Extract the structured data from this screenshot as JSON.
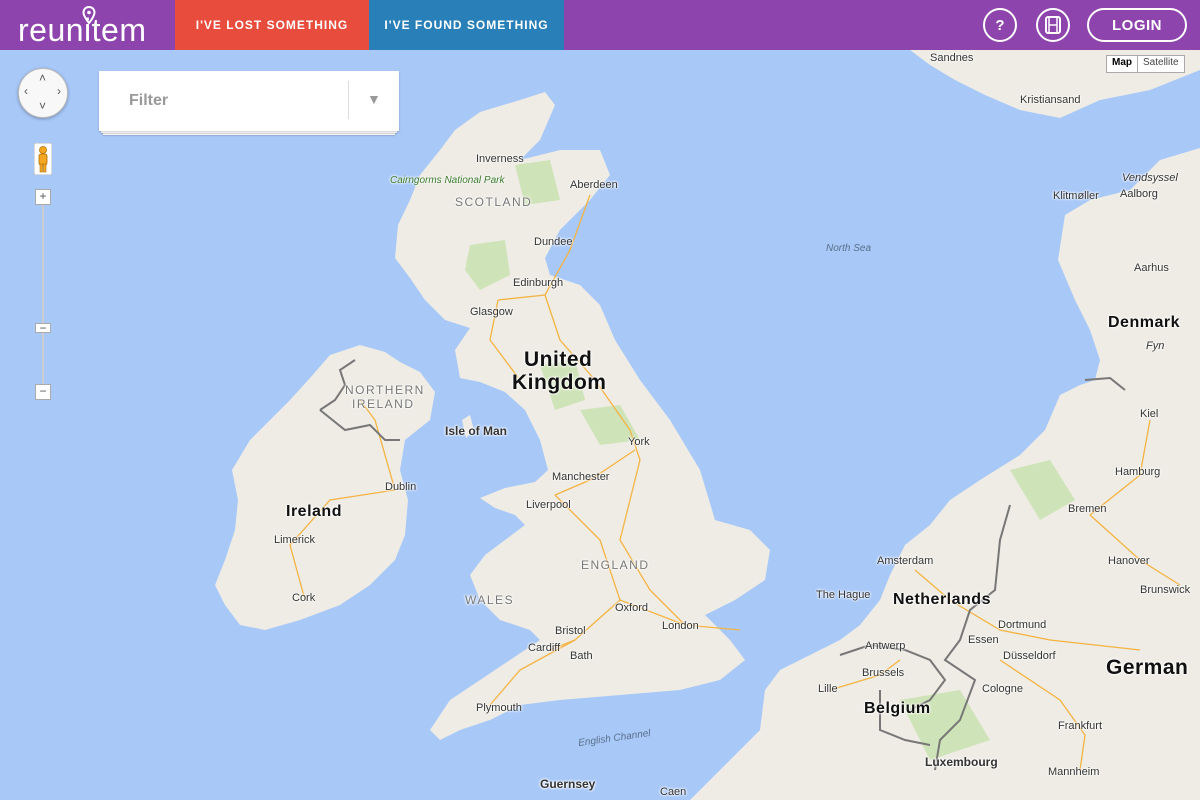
{
  "header": {
    "logo_text": "reunitem",
    "nav_lost": "I'VE LOST SOMETHING",
    "nav_found": "I'VE FOUND SOMETHING",
    "help_label": "?",
    "login_label": "LOGIN",
    "colors": {
      "bar": "#8e44ad",
      "lost": "#e74c3c",
      "found": "#2980b9"
    }
  },
  "filter": {
    "label": "Filter"
  },
  "map_controls": {
    "zoom_in": "+",
    "zoom_out": "−",
    "maptype_map": "Map",
    "maptype_satellite": "Satellite",
    "pan_icon": "pan-icon",
    "pegman_icon": "pegman-icon"
  },
  "map_labels": {
    "sandnes": "Sandnes",
    "kristiansand": "Kristiansand",
    "vendsyssel": "Vendsyssel",
    "klitmoller": "Klitmøller",
    "aalborg": "Aalborg",
    "aarhus": "Aarhus",
    "denmark": "Denmark",
    "fyn": "Fyn",
    "kiel": "Kiel",
    "hamburg": "Hamburg",
    "bremen": "Bremen",
    "hanover": "Hanover",
    "brunswick": "Brunswick",
    "germany": "German",
    "inverness": "Inverness",
    "cairngorms": "Cairngorms National Park",
    "aberdeen": "Aberdeen",
    "scotland": "SCOTLAND",
    "dundee": "Dundee",
    "edinburgh": "Edinburgh",
    "glasgow": "Glasgow",
    "north_sea": "North Sea",
    "uk_line1": "United",
    "uk_line2": "Kingdom",
    "ni_line1": "NORTHERN",
    "ni_line2": "IRELAND",
    "isle_of_man": "Isle of Man",
    "york": "York",
    "manchester": "Manchester",
    "liverpool": "Liverpool",
    "dublin": "Dublin",
    "ireland": "Ireland",
    "limerick": "Limerick",
    "cork": "Cork",
    "england": "ENGLAND",
    "wales": "WALES",
    "oxford": "Oxford",
    "bristol": "Bristol",
    "cardiff": "Cardiff",
    "bath": "Bath",
    "london": "London",
    "plymouth": "Plymouth",
    "english_channel": "English Channel",
    "guernsey": "Guernsey",
    "caen": "Caen",
    "amsterdam": "Amsterdam",
    "the_hague": "The Hague",
    "netherlands": "Netherlands",
    "dortmund": "Dortmund",
    "essen": "Essen",
    "dusseldorf": "Düsseldorf",
    "cologne": "Cologne",
    "antwerp": "Antwerp",
    "brussels": "Brussels",
    "lille": "Lille",
    "belgium": "Belgium",
    "luxembourg": "Luxembourg",
    "frankfurt": "Frankfurt",
    "mannheim": "Mannheim"
  }
}
